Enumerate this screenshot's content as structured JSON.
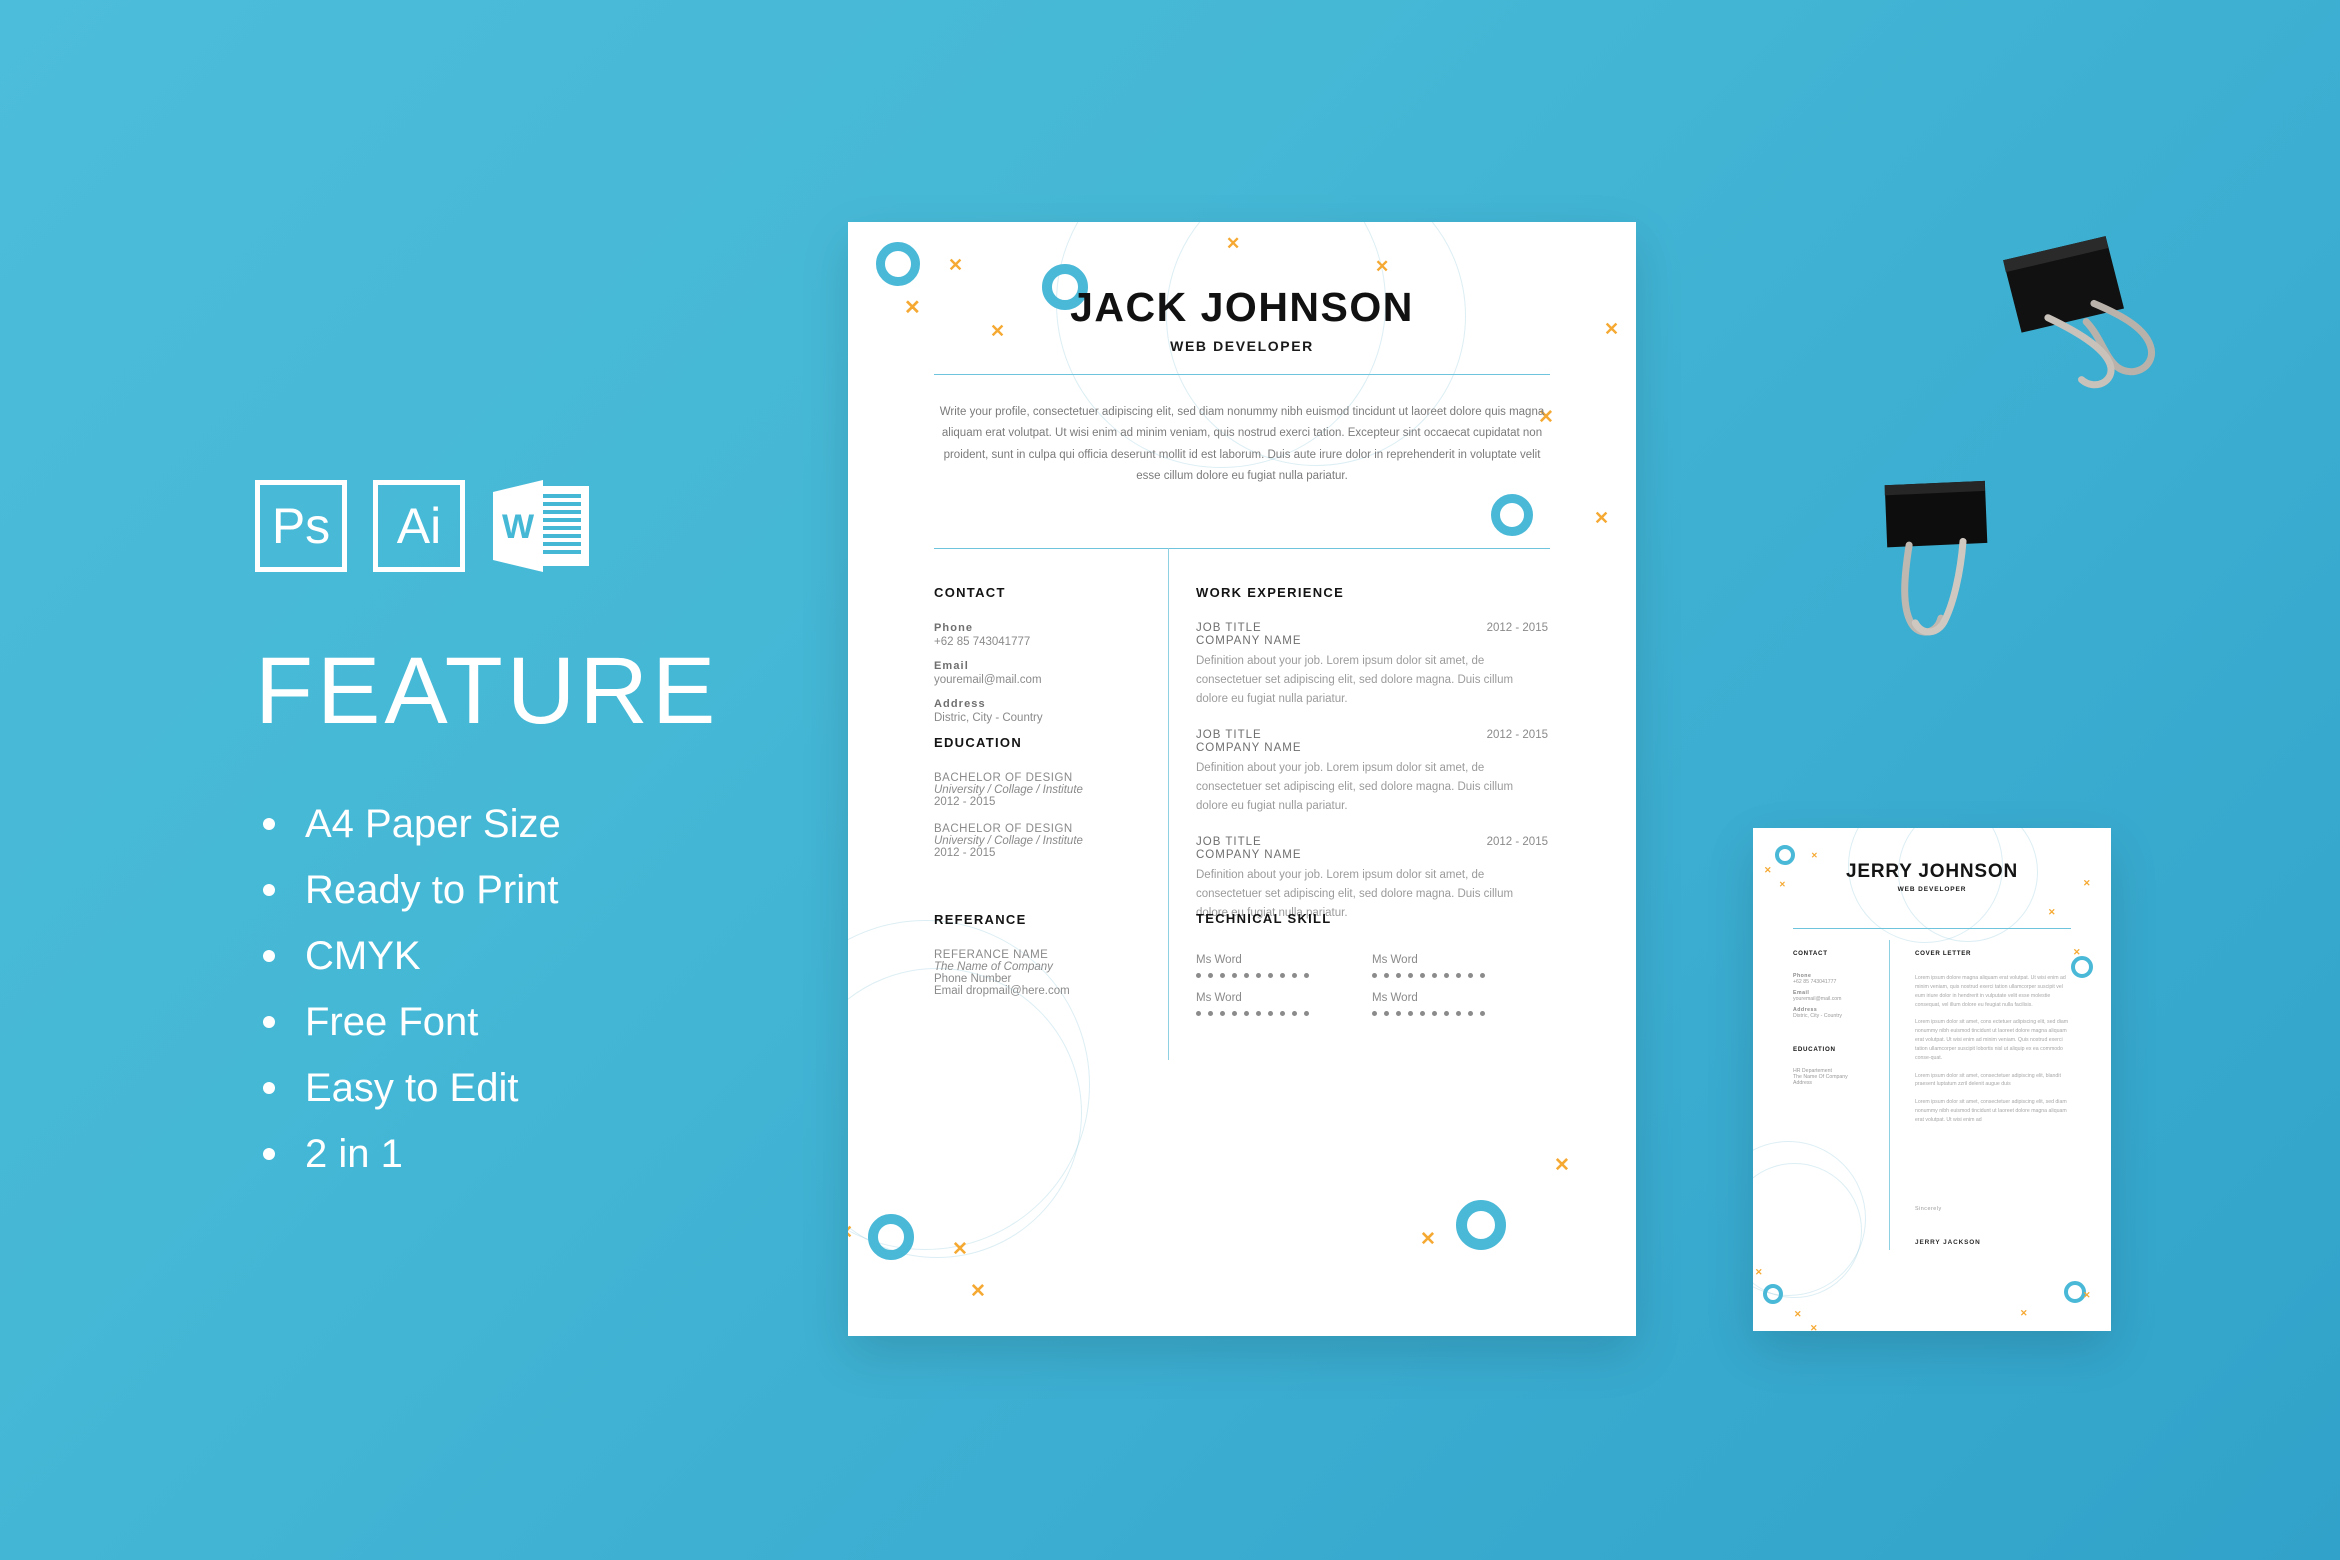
{
  "theme": {
    "background_top_left": "#4cbdda",
    "background_bottom_right": "#31a2c9",
    "accent_cyan": "#4ab9d8",
    "accent_orange": "#f5a932",
    "paper": "#ffffff"
  },
  "feature_panel": {
    "software_badges": [
      {
        "icon": "photoshop-icon",
        "label": "Ps"
      },
      {
        "icon": "illustrator-icon",
        "label": "Ai"
      },
      {
        "icon": "microsoft-word-icon",
        "label": "W"
      }
    ],
    "title": "FEATURE",
    "items": [
      "A4 Paper Size",
      "Ready to Print",
      "CMYK",
      "Free Font",
      "Easy to Edit",
      "2 in 1"
    ]
  },
  "resume_main": {
    "name": "JACK JOHNSON",
    "role": "WEB DEVELOPER",
    "profile": "Write your profile, consectetuer adipiscing elit, sed diam nonummy nibh euismod tincidunt ut laoreet dolore quis magna aliquam erat volutpat. Ut wisi enim ad minim veniam, quis nostrud exerci tation. Excepteur sint occaecat cupidatat non proident, sunt in culpa qui officia deserunt mollit  id est laborum. Duis aute irure dolor in reprehenderit in voluptate velit esse cillum dolore eu fugiat nulla pariatur.",
    "contact": {
      "heading": "CONTACT",
      "fields": [
        {
          "label": "Phone",
          "value": "+62 85 743041777"
        },
        {
          "label": "Email",
          "value": "youremail@mail.com"
        },
        {
          "label": "Address",
          "value": "Distric, City - Country"
        }
      ]
    },
    "education": {
      "heading": "EDUCATION",
      "items": [
        {
          "degree": "BACHELOR OF DESIGN",
          "institute": "University / Collage / Institute",
          "years": "2012 - 2015"
        },
        {
          "degree": "BACHELOR OF DESIGN",
          "institute": "University / Collage / Institute",
          "years": "2012 - 2015"
        }
      ]
    },
    "referance": {
      "heading": "REFERANCE",
      "name": "REFERANCE NAME",
      "company": "The Name of Company",
      "phone": "Phone Number",
      "email": "Email dropmail@here.com"
    },
    "work_experience": {
      "heading": "WORK EXPERIENCE",
      "jobs": [
        {
          "title": "JOB TITLE",
          "date": "2012 - 2015",
          "company": "COMPANY NAME",
          "description": "Definition about your job. Lorem ipsum dolor sit amet, de consectetuer set adipiscing elit, sed dolore magna. Duis cillum dolore eu fugiat nulla pariatur."
        },
        {
          "title": "JOB TITLE",
          "date": "2012 - 2015",
          "company": "COMPANY NAME",
          "description": "Definition about your job. Lorem ipsum dolor sit amet, de consectetuer set adipiscing elit, sed dolore magna. Duis cillum dolore eu fugiat nulla pariatur."
        },
        {
          "title": "JOB TITLE",
          "date": "2012 - 2015",
          "company": "COMPANY NAME",
          "description": "Definition about your job. Lorem ipsum dolor sit amet, de consectetuer set adipiscing elit, sed dolore magna. Duis cillum dolore eu fugiat nulla pariatur."
        }
      ]
    },
    "technical_skill": {
      "heading": "TECHNICAL SKILL",
      "skills": [
        {
          "name": "Ms Word",
          "dots": 10
        },
        {
          "name": "Ms Word",
          "dots": 10
        },
        {
          "name": "Ms Word",
          "dots": 10
        },
        {
          "name": "Ms Word",
          "dots": 10
        }
      ]
    }
  },
  "resume_second": {
    "name": "JERRY JOHNSON",
    "role": "WEB DEVELOPER",
    "contact": {
      "heading": "CONTACT",
      "fields": [
        {
          "label": "Phone",
          "value": "+62 85 743041777"
        },
        {
          "label": "Email",
          "value": "youremail@mail.com"
        },
        {
          "label": "Address",
          "value": "Distric, City - Country"
        }
      ]
    },
    "education": {
      "heading": "EDUCATION",
      "lines": [
        "HR Departement",
        "The Name Of Company",
        "Address"
      ]
    },
    "cover_letter": {
      "heading": "COVER LETTER",
      "paragraphs": [
        "Lorem ipsum dolore magna aliquam erat volutpat. Ut wisi enim ad minim veniam, quis nostrud exerci tation ullamcorper suscipit  vel eum iriure dolor in hendrerit in vulputate velit esse molestie consequat, vel illum dolore eu feugiat nulla facilisis.",
        "Lorem ipsum dolor sit amet, cons ectetuer adipiscing elit, sed diam nonummy nibh euismod tincidunt ut laoreet dolore magna aliquam erat volutpat. Ut wisi enim ad minim veniam. Quis nostrud exerci tation ullamcorper suscipit lobortis nisl ut aliquip ex ea commodo conse-quat.",
        "Lorem ipsum dolor sit amet, consectetuer adipiscing elit, blandit praesent luptatum zzril delenit augue duis",
        "Lorem ipsum dolor sit amet, consectetuer adipiscing elit, sed diam nonummy nibh euismod tincidunt ut laoreet dolore magna aliquam erat volutpat. Ut wisi enim ad"
      ],
      "closing": "Sincerely",
      "signature": "JERRY JACKSON"
    }
  },
  "decor": {
    "binder_clip_top": "binder-clip-icon",
    "binder_clip_bottom": "binder-clip-icon"
  }
}
